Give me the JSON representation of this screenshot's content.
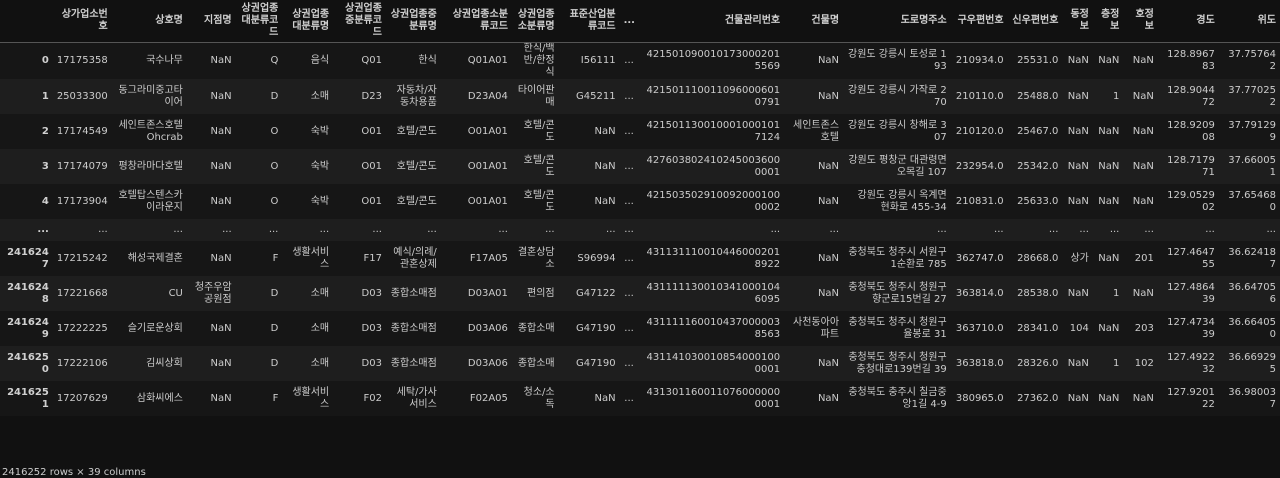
{
  "table": {
    "columns": [
      "",
      "상가업소번호",
      "상호명",
      "지점명",
      "상권업종대분류코드",
      "상권업종대분류명",
      "상권업종중분류코드",
      "상권업종중분류명",
      "상권업종소분류코드",
      "상권업종소분류명",
      "표준산업분류코드",
      "...",
      "건물관리번호",
      "건물명",
      "도로명주소",
      "구우편번호",
      "신우편번호",
      "동정보",
      "층정보",
      "호정보",
      "경도",
      "위도"
    ],
    "rows": [
      [
        "0",
        "17175358",
        "국수나무",
        "NaN",
        "Q",
        "음식",
        "Q01",
        "한식",
        "Q01A01",
        "한식/백반/한정식",
        "I56111",
        "...",
        "4215010900101730002015569",
        "NaN",
        "강원도 강릉시 토성로 193",
        "210934.0",
        "25531.0",
        "NaN",
        "NaN",
        "NaN",
        "128.896783",
        "37.757642"
      ],
      [
        "1",
        "25033300",
        "동그라미중고타이어",
        "NaN",
        "D",
        "소매",
        "D23",
        "자동차/자동차용품",
        "D23A04",
        "타이어판매",
        "G45211",
        "...",
        "4215011100110960006010791",
        "NaN",
        "강원도 강릉시 가작로 270",
        "210110.0",
        "25488.0",
        "NaN",
        "1",
        "NaN",
        "128.904472",
        "37.770252"
      ],
      [
        "2",
        "17174549",
        "세인트존스호텔Ohcrab",
        "NaN",
        "O",
        "숙박",
        "O01",
        "호텔/콘도",
        "O01A01",
        "호텔/콘도",
        "NaN",
        "...",
        "4215011300100010001017124",
        "세인트존스호텔",
        "강원도 강릉시 창해로 307",
        "210120.0",
        "25467.0",
        "NaN",
        "NaN",
        "NaN",
        "128.920908",
        "37.791299"
      ],
      [
        "3",
        "17174079",
        "평창라마다호텔",
        "NaN",
        "O",
        "숙박",
        "O01",
        "호텔/콘도",
        "O01A01",
        "호텔/콘도",
        "NaN",
        "...",
        "4276038024102450036000001",
        "NaN",
        "강원도 평창군 대관령면 오목길 107",
        "232954.0",
        "25342.0",
        "NaN",
        "NaN",
        "NaN",
        "128.717971",
        "37.660051"
      ],
      [
        "4",
        "17173904",
        "호텔탑스텐스카이라운지",
        "NaN",
        "O",
        "숙박",
        "O01",
        "호텔/콘도",
        "O01A01",
        "호텔/콘도",
        "NaN",
        "...",
        "4215035029100920001000002",
        "NaN",
        "강원도 강릉시 옥계면 현화로 455-34",
        "210831.0",
        "25633.0",
        "NaN",
        "NaN",
        "NaN",
        "129.052902",
        "37.654680"
      ],
      [
        "...",
        "...",
        "...",
        "...",
        "...",
        "...",
        "...",
        "...",
        "...",
        "...",
        "...",
        "...",
        "...",
        "...",
        "...",
        "...",
        "...",
        "...",
        "...",
        "...",
        "...",
        "..."
      ],
      [
        "2416247",
        "17215242",
        "해성국제결혼",
        "NaN",
        "F",
        "생활서비스",
        "F17",
        "예식/의례/관혼상제",
        "F17A05",
        "결혼상담소",
        "S96994",
        "...",
        "4311311100104460002018922",
        "NaN",
        "충청북도 청주시 서원구 1순환로 785",
        "362747.0",
        "28668.0",
        "상가",
        "NaN",
        "201",
        "127.464755",
        "36.624187"
      ],
      [
        "2416248",
        "17221668",
        "CU",
        "청주우암공원점",
        "D",
        "소매",
        "D03",
        "종합소매점",
        "D03A01",
        "편의점",
        "G47122",
        "...",
        "4311111300103410001046095",
        "NaN",
        "충청북도 청주시 청원구 향군로15번길 27",
        "363814.0",
        "28538.0",
        "NaN",
        "1",
        "NaN",
        "127.486439",
        "36.647056"
      ],
      [
        "2416249",
        "17222225",
        "슬기로운상회",
        "NaN",
        "D",
        "소매",
        "D03",
        "종합소매점",
        "D03A06",
        "종합소매",
        "G47190",
        "...",
        "4311111600104370000038563",
        "사천동아아파트",
        "충청북도 청주시 청원구 율봉로 31",
        "363710.0",
        "28341.0",
        "104",
        "NaN",
        "203",
        "127.473439",
        "36.664050"
      ],
      [
        "2416250",
        "17222106",
        "김씨상회",
        "NaN",
        "D",
        "소매",
        "D03",
        "종합소매점",
        "D03A06",
        "종합소매",
        "G47190",
        "...",
        "4311410300108540001000001",
        "NaN",
        "충청북도 청주시 청원구 충청대로139번길 39",
        "363818.0",
        "28326.0",
        "NaN",
        "1",
        "102",
        "127.492232",
        "36.669295"
      ],
      [
        "2416251",
        "17207629",
        "삼화씨에스",
        "NaN",
        "F",
        "생활서비스",
        "F02",
        "세탁/가사서비스",
        "F02A05",
        "청소/소독",
        "NaN",
        "...",
        "4313011600110760000000001",
        "NaN",
        "충청북도 충주시 칠금중앙1길 4-9",
        "380965.0",
        "27362.0",
        "NaN",
        "NaN",
        "NaN",
        "127.920122",
        "36.980037"
      ]
    ]
  },
  "footer": "2416252 rows × 39 columns"
}
